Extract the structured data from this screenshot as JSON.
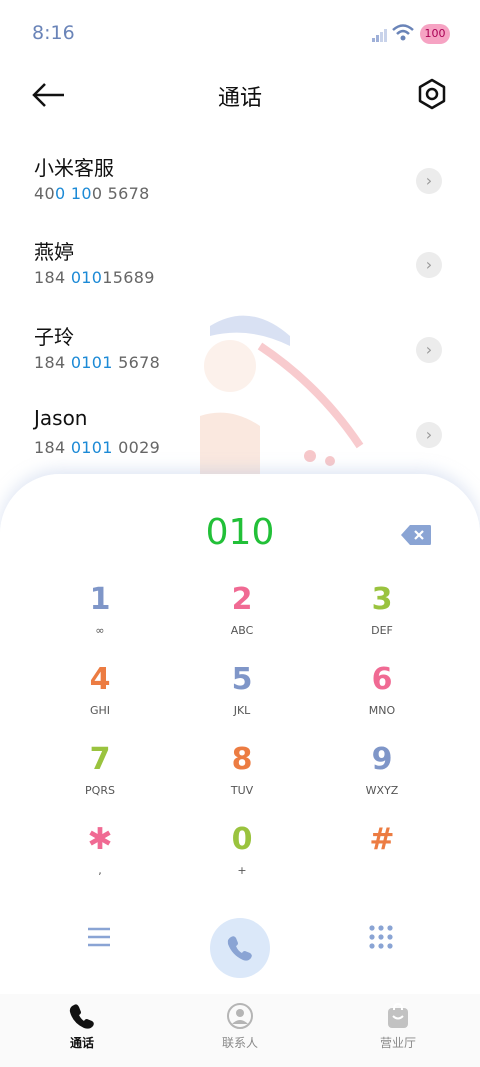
{
  "status_bar": {
    "time": "8:16",
    "battery": "100"
  },
  "header": {
    "title": "通话"
  },
  "contacts": [
    {
      "name": "小米客服",
      "number_pre": "40",
      "number_hl1": "0",
      "number_mid": " ",
      "number_hl2": "10",
      "number_post": "0 5678"
    },
    {
      "name": "燕婷",
      "number_pre": "184 ",
      "number_hl1": "010",
      "number_mid": "",
      "number_hl2": "",
      "number_post": "15689"
    },
    {
      "name": "子玲",
      "number_pre": "184 ",
      "number_hl1": "0101",
      "number_mid": "",
      "number_hl2": "",
      "number_post": " 5678"
    },
    {
      "name": "Jason",
      "number_pre": "184 ",
      "number_hl1": "0101",
      "number_mid": "",
      "number_hl2": "",
      "number_post": " 0029"
    }
  ],
  "dialer": {
    "entered": "010",
    "keys": [
      {
        "num": "1",
        "letters": "∞",
        "color": "#7f96c8"
      },
      {
        "num": "2",
        "letters": "ABC",
        "color": "#f06a93"
      },
      {
        "num": "3",
        "letters": "DEF",
        "color": "#9ac33e"
      },
      {
        "num": "4",
        "letters": "GHI",
        "color": "#ec7c42"
      },
      {
        "num": "5",
        "letters": "JKL",
        "color": "#7f96c8"
      },
      {
        "num": "6",
        "letters": "MNO",
        "color": "#f06a93"
      },
      {
        "num": "7",
        "letters": "PQRS",
        "color": "#9ac33e"
      },
      {
        "num": "8",
        "letters": "TUV",
        "color": "#ec7c42"
      },
      {
        "num": "9",
        "letters": "WXYZ",
        "color": "#7f96c8"
      },
      {
        "num": "✱",
        "letters": ",",
        "color": "#f06a93"
      },
      {
        "num": "0",
        "letters": "+",
        "color": "#9ac33e"
      },
      {
        "num": "#",
        "letters": "",
        "color": "#ec7c42"
      }
    ]
  },
  "tabs": [
    {
      "label": "通话",
      "icon": "phone-icon",
      "active": true
    },
    {
      "label": "联系人",
      "icon": "contacts-icon",
      "active": false
    },
    {
      "label": "营业厅",
      "icon": "shop-bag-icon",
      "active": false
    }
  ],
  "colors": {
    "accent_green": "#22c038",
    "highlight_blue": "#1c8ad6",
    "call_button": "#dbe8f9"
  }
}
